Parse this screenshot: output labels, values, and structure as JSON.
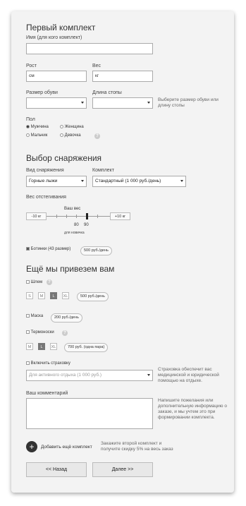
{
  "kit1": {
    "title": "Первый комплект",
    "name_label": "Имя (для кого комплект)",
    "height_label": "Рост",
    "height_unit": "см",
    "weight_label": "Вес",
    "weight_unit": "кг",
    "shoe_label": "Размер обуви",
    "foot_label": "Длина стопы",
    "shoe_hint": "Выберите размер обуви или длину стопы",
    "gender_label": "Пол",
    "gender_options": [
      "Мужчина",
      "Женщина",
      "Мальчик",
      "Девочка"
    ],
    "gender_selected": "Мужчина",
    "help": "?"
  },
  "equipment": {
    "title": "Выбор снаряжения",
    "type_label": "Вид снаряжения",
    "type_value": "Горные лыжи",
    "kit_label": "Комплект",
    "kit_value": "Стандартный (1 000 руб./день)",
    "binding_label": "Вес отстегивания",
    "slider": {
      "minus": "-10 кг",
      "plus": "+10 кг",
      "your_weight": "Ваш вес",
      "tick_80": "80",
      "tick_90": "90",
      "beginner": "для новичка"
    },
    "boots_label": "Ботинки (43 размер)",
    "boots_checked": true,
    "boots_price": "500 руб./день"
  },
  "extras": {
    "title": "Ещё мы привезем вам",
    "helmet_label": "Шлем",
    "helmet_sizes": [
      "S",
      "M",
      "L",
      "XL"
    ],
    "helmet_selected": "L",
    "helmet_price": "500 руб./день",
    "mask_label": "Маска",
    "mask_price": "200 руб./день",
    "thermos_label": "Термоноски",
    "thermos_sizes": [
      "M",
      "L",
      "XL"
    ],
    "thermos_selected": "L",
    "thermos_price": "700 руб. (одна пара)",
    "insurance_label": "Включить страховку",
    "insurance_select": "Для активного отдыха (1 000 руб.)",
    "insurance_note": "Страховка обеспечит вас медицинской и юридической помощью на отдыхе.",
    "comment_label": "Ваш комментарий",
    "comment_note": "Напишите пожелания или дополнительную информацию о заказе, и мы учтем это при формировании комплекта."
  },
  "footer": {
    "add_kit_label": "Добавить ещё комплект",
    "add_kit_note": "Закажите второй комплект и получите скидку 5% на весь заказ",
    "back_label": "<< Назад",
    "next_label": "Далее >>"
  }
}
